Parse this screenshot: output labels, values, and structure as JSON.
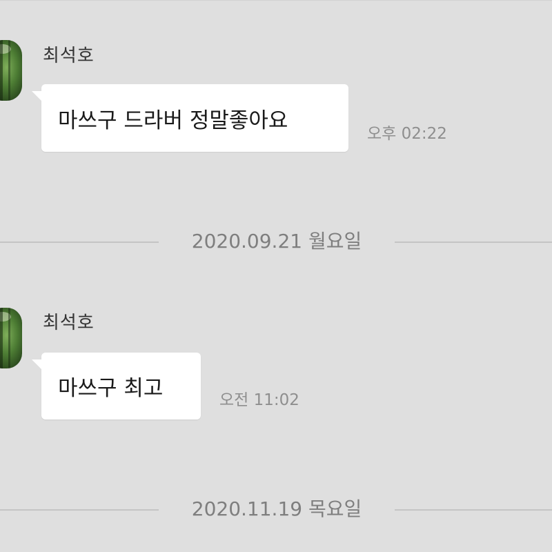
{
  "messages": [
    {
      "sender": "최석호",
      "text": "마쓰구 드라버 정말좋아요",
      "time": "오후 02:22",
      "avatar_icon": "profile-photo-forest"
    },
    {
      "sender": "최석호",
      "text": "마쓰구 최고",
      "time": "오전 11:02",
      "avatar_icon": "profile-photo-forest"
    }
  ],
  "date_dividers": [
    {
      "label": "2020.09.21 월요일"
    },
    {
      "label": "2020.11.19 목요일"
    }
  ],
  "colors": {
    "background": "#dfdfdf",
    "bubble": "#ffffff",
    "time_text": "#8e8e8e",
    "divider": "#c4c4c4"
  }
}
